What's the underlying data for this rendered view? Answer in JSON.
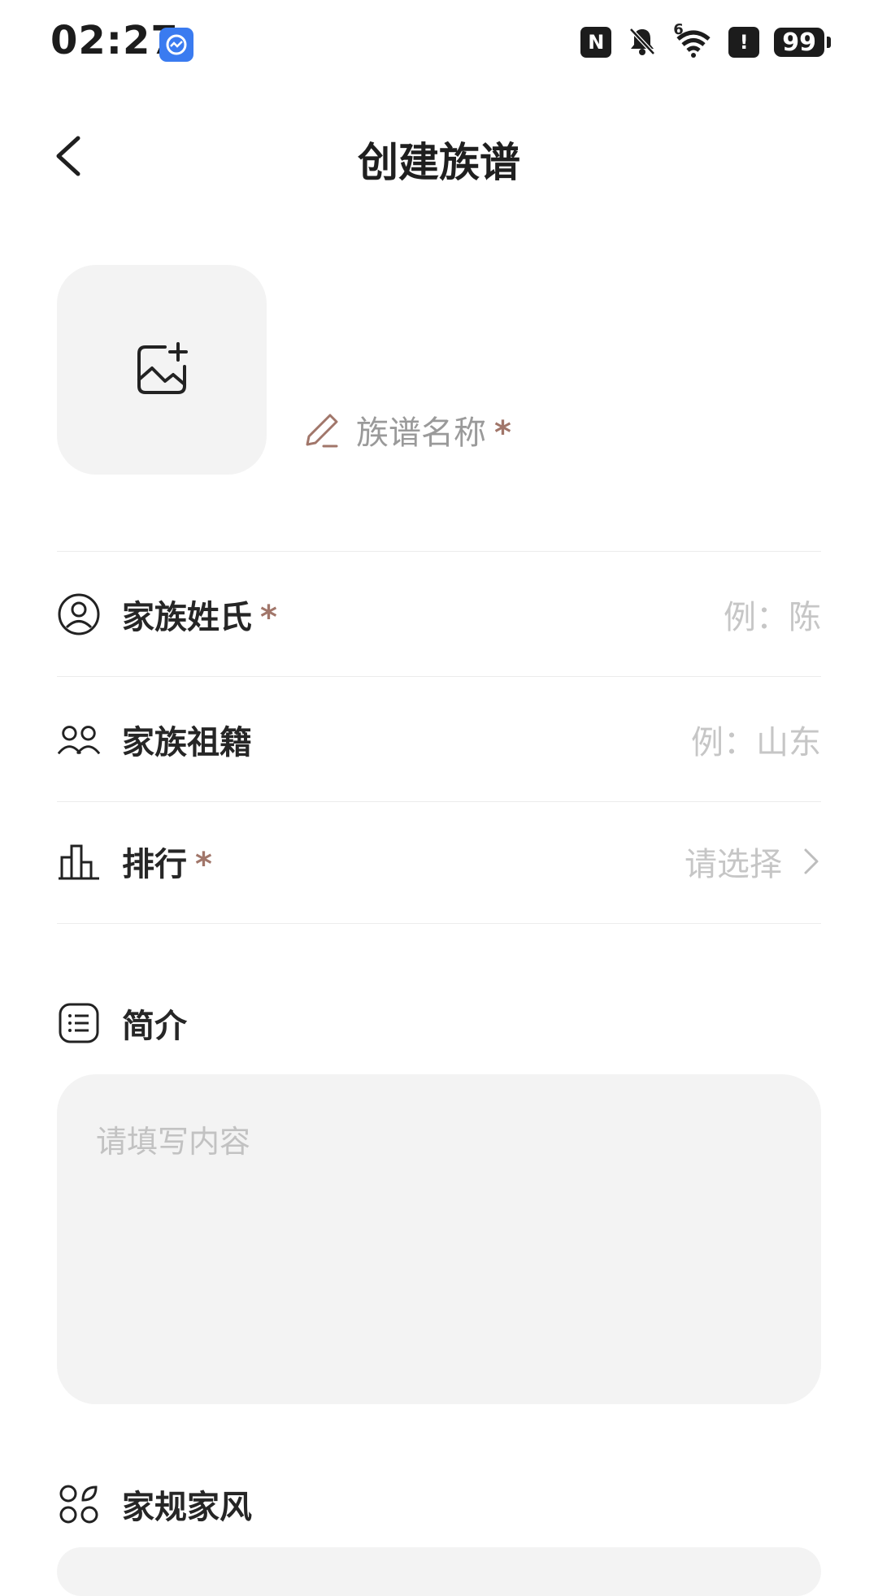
{
  "status_bar": {
    "time": "02:27",
    "nfc": "N",
    "signal_label": "6",
    "alert": "!",
    "battery": "99"
  },
  "header": {
    "title": "创建族谱"
  },
  "cover": {
    "name_placeholder": "族谱名称",
    "required_mark": "*"
  },
  "form": {
    "surname": {
      "label": "家族姓氏",
      "required_mark": "*",
      "placeholder": "例：陈"
    },
    "origin": {
      "label": "家族祖籍",
      "placeholder": "例：山东"
    },
    "rank": {
      "label": "排行",
      "required_mark": "*",
      "value": "请选择"
    }
  },
  "intro": {
    "label": "简介",
    "placeholder": "请填写内容"
  },
  "rules": {
    "label": "家规家风"
  },
  "colors": {
    "required": "#a1766a",
    "placeholder": "#c6c6c6",
    "field_bg": "#f3f3f3"
  }
}
